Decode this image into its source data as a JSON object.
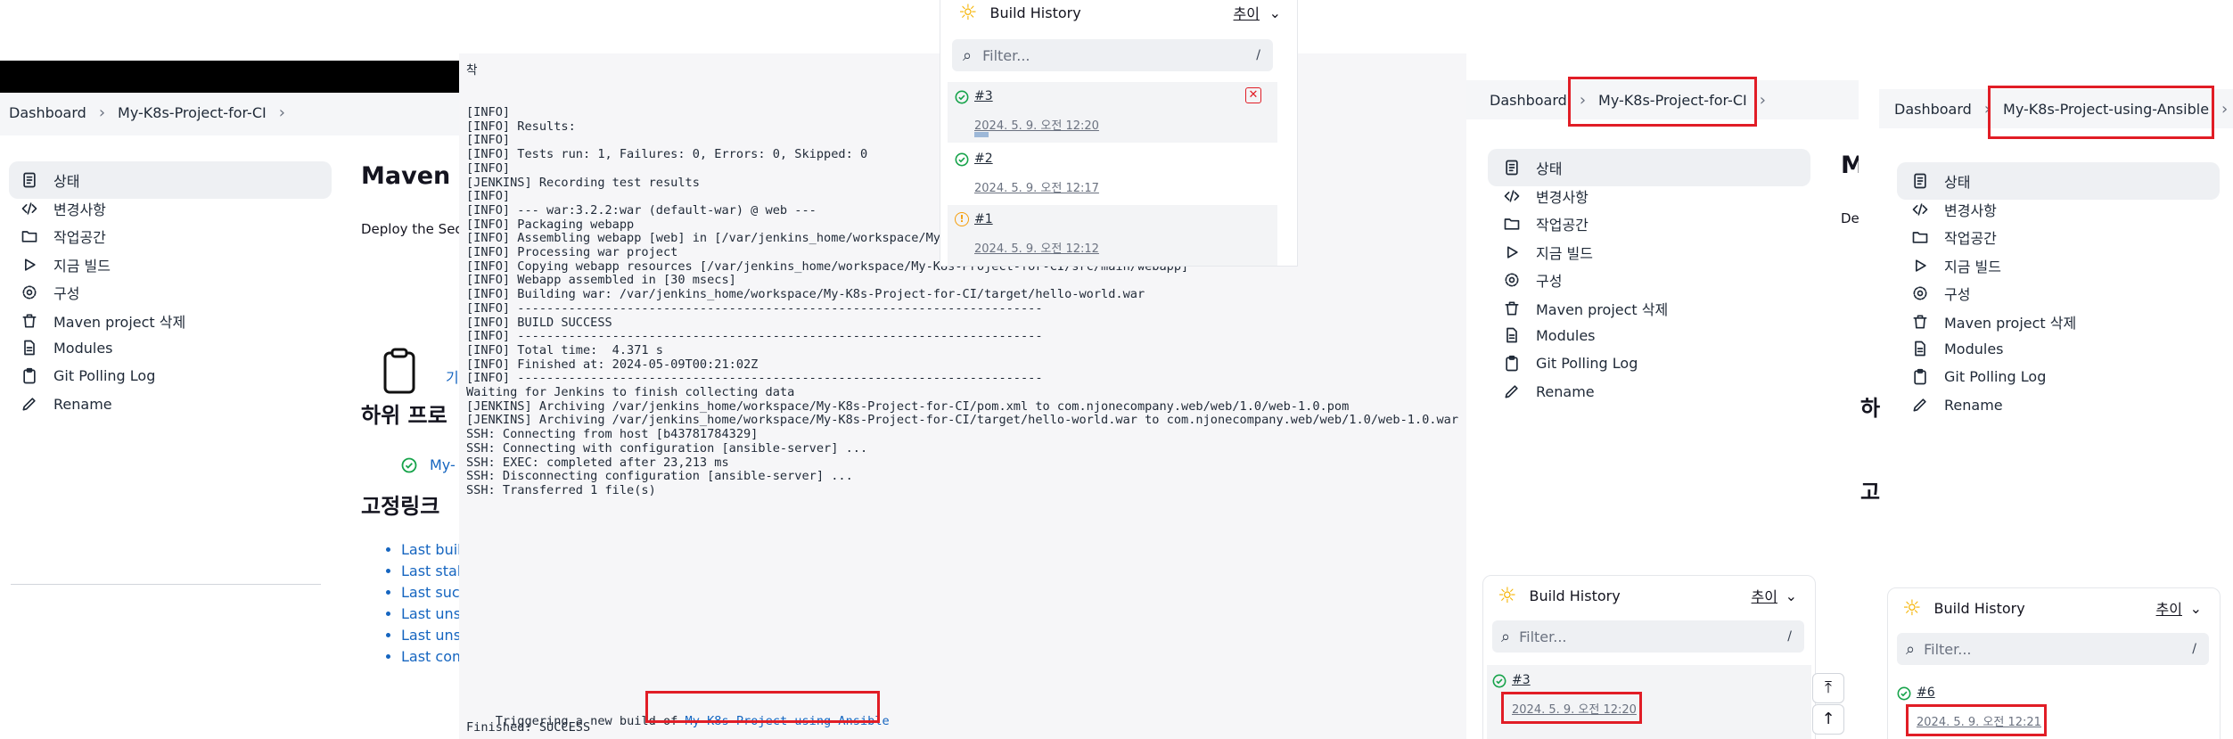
{
  "left": {
    "breadcrumb": [
      "Dashboard",
      "My-K8s-Project-for-CI"
    ],
    "sidebar": [
      "상태",
      "변경사항",
      "작업공간",
      "지금 빌드",
      "구성",
      "Maven project 삭제",
      "Modules",
      "Git Polling Log",
      "Rename"
    ],
    "title": "Maven p",
    "description": "Deploy the Sec",
    "subprojects_heading": "하위 프로",
    "subproject_item": "My-",
    "subproject_hint": "기",
    "permalinks_heading": "고정링크",
    "permalinks": [
      "Last build",
      "Last stab",
      "Last succ",
      "Last unst",
      "Last unsu",
      "Last com"
    ]
  },
  "console": {
    "header_fragment": "착",
    "lines": [
      "[INFO]",
      "[INFO] Results:",
      "[INFO]",
      "[INFO] Tests run: 1, Failures: 0, Errors: 0, Skipped: 0",
      "[INFO]",
      "[JENKINS] Recording test results",
      "[INFO]",
      "[INFO] --- war:3.2.2:war (default-war) @ web ---",
      "[INFO] Packaging webapp",
      "[INFO] Assembling webapp [web] in [/var/jenkins_home/workspace/My-K8s-Project-for-CI/target/hello-world]",
      "[INFO] Processing war project",
      "[INFO] Copying webapp resources [/var/jenkins_home/workspace/My-K8s-Project-for-CI/src/main/webapp]",
      "[INFO] Webapp assembled in [30 msecs]",
      "[INFO] Building war: /var/jenkins_home/workspace/My-K8s-Project-for-CI/target/hello-world.war",
      "[INFO] ------------------------------------------------------------------------",
      "[INFO] BUILD SUCCESS",
      "[INFO] ------------------------------------------------------------------------",
      "[INFO] Total time:  4.371 s",
      "[INFO] Finished at: 2024-05-09T00:21:02Z",
      "[INFO] ------------------------------------------------------------------------",
      "Waiting for Jenkins to finish collecting data",
      "[JENKINS] Archiving /var/jenkins_home/workspace/My-K8s-Project-for-CI/pom.xml to com.njonecompany.web/web/1.0/web-1.0.pom",
      "[JENKINS] Archiving /var/jenkins_home/workspace/My-K8s-Project-for-CI/target/hello-world.war to com.njonecompany.web/web/1.0/web-1.0.war",
      "SSH: Connecting from host [b43781784329]",
      "SSH: Connecting with configuration [ansible-server] ...",
      "SSH: EXEC: completed after 23,213 ms",
      "SSH: Disconnecting configuration [ansible-server] ...",
      "SSH: Transferred 1 file(s)"
    ],
    "trigger_prefix": "Triggering a new build of ",
    "trigger_link": "My-K8s-Project-using-Ansible",
    "finished": "Finished: SUCCESS"
  },
  "popup": {
    "title": "Build History",
    "trend": "추이",
    "filter_placeholder": "Filter...",
    "slash": "/",
    "builds": [
      {
        "num": "#3",
        "date": "2024. 5. 9. 오전 12:20",
        "status": "success"
      },
      {
        "num": "#2",
        "date": "2024. 5. 9. 오전 12:17",
        "status": "success"
      },
      {
        "num": "#1",
        "date": "2024. 5. 9. 오전 12:12",
        "status": "unstable"
      }
    ]
  },
  "mid": {
    "breadcrumb": [
      "Dashboard",
      "My-K8s-Project-for-CI"
    ],
    "sidebar": [
      "상태",
      "변경사항",
      "작업공간",
      "지금 빌드",
      "구성",
      "Maven project 삭제",
      "Modules",
      "Git Polling Log",
      "Rename"
    ],
    "title_fragment": "M",
    "desc_fragment": "De",
    "build_history": {
      "title": "Build History",
      "trend": "추이",
      "filter_placeholder": "Filter...",
      "slash": "/",
      "build_num": "#3",
      "build_date": "2024. 5. 9. 오전 12:20"
    }
  },
  "right": {
    "breadcrumb": [
      "Dashboard",
      "My-K8s-Project-using-Ansible"
    ],
    "sidebar": [
      "상태",
      "변경사항",
      "작업공간",
      "지금 빌드",
      "구성",
      "Maven project 삭제",
      "Modules",
      "Git Polling Log",
      "Rename"
    ],
    "frag_a": "하",
    "frag_b": "고",
    "build_history": {
      "title": "Build History",
      "trend": "추이",
      "filter_placeholder": "Filter...",
      "slash": "/",
      "build_num": "#6",
      "build_date": "2024. 5. 9. 오전 12:21"
    }
  },
  "colors": {
    "highlight": "#e11d26",
    "link": "#1565c0",
    "success": "#16a34a",
    "unstable": "#f59e0b",
    "sun": "#f5b301"
  }
}
